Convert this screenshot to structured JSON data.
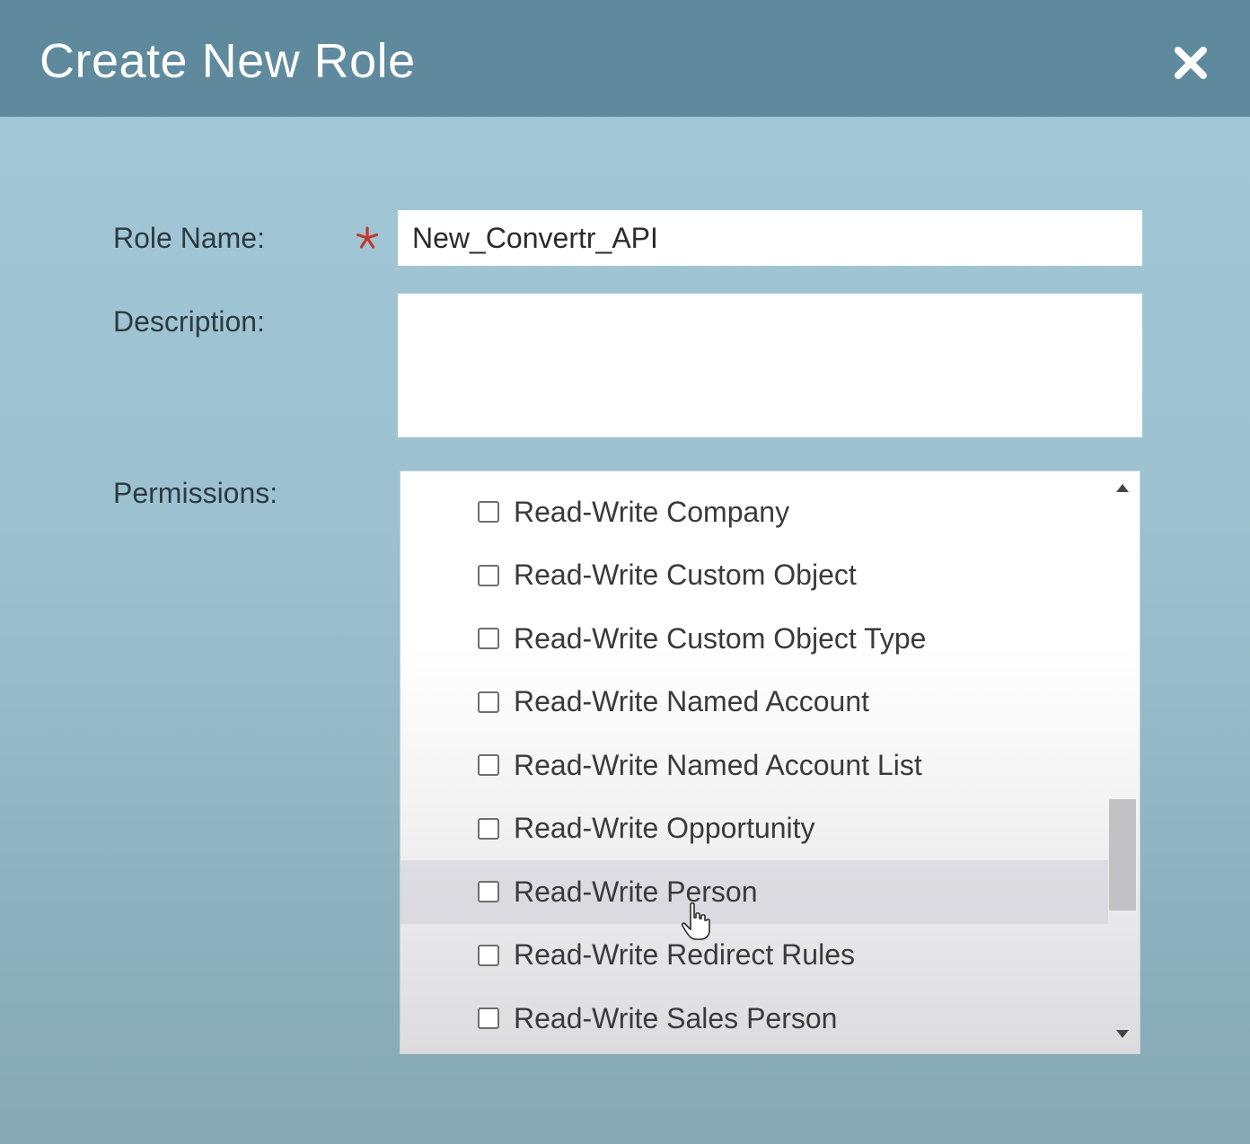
{
  "dialog": {
    "title": "Create New Role",
    "close_icon": "close-icon"
  },
  "form": {
    "role_name_label": "Role Name:",
    "role_name_value": "New_Convertr_API",
    "description_label": "Description:",
    "description_value": "",
    "permissions_label": "Permissions:"
  },
  "permissions": [
    {
      "label": "Read-Write Company",
      "checked": false
    },
    {
      "label": "Read-Write Custom Object",
      "checked": false
    },
    {
      "label": "Read-Write Custom Object Type",
      "checked": false
    },
    {
      "label": "Read-Write Named Account",
      "checked": false
    },
    {
      "label": "Read-Write Named Account List",
      "checked": false
    },
    {
      "label": "Read-Write Opportunity",
      "checked": false
    },
    {
      "label": "Read-Write Person",
      "checked": false
    },
    {
      "label": "Read-Write Redirect Rules",
      "checked": false
    },
    {
      "label": "Read-Write Sales Person",
      "checked": false
    }
  ],
  "colors": {
    "titlebar": "#5f8a9d",
    "background": "#a3c8d7",
    "required_star": "#c0392b"
  }
}
